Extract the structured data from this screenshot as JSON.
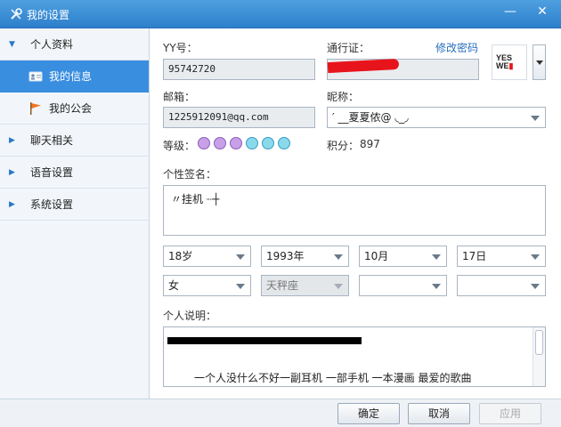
{
  "window": {
    "title": "我的设置",
    "minimize": "—",
    "close": "✕"
  },
  "sidebar": {
    "sections": [
      {
        "label": "个人资料",
        "expanded": true
      },
      {
        "label": "聊天相关",
        "expanded": false
      },
      {
        "label": "语音设置",
        "expanded": false
      },
      {
        "label": "系统设置",
        "expanded": false
      }
    ],
    "sub_items": [
      {
        "label": "我的信息",
        "icon": "id-card-icon",
        "active": true
      },
      {
        "label": "我的公会",
        "icon": "flag-icon",
        "active": false
      }
    ]
  },
  "profile": {
    "yy_label": "YY号：",
    "yy_value": "95742720",
    "passport_label": "通行证：",
    "change_password": "修改密码",
    "email_label": "邮箱：",
    "email_value": "1225912091@qq.com",
    "nickname_label": "昵称：",
    "nickname_value": "′ __夏夏侬@ ◟_◞",
    "level_label": "等级：",
    "level_icons": [
      "crown-icon",
      "crown-icon",
      "crown-icon",
      "diamond-icon",
      "diamond-icon",
      "diamond-icon"
    ],
    "points_label": "积分：",
    "points_value": "897",
    "signature_label": "个性签名：",
    "signature_value": "〃挂机 ┈┼",
    "age": "18岁",
    "birth_year": "1993年",
    "birth_month": "10月",
    "birth_day": "17日",
    "gender": "女",
    "zodiac": "天秤座",
    "province": "",
    "city": "",
    "bio_label": "个人说明：",
    "bio_text": "一个人没什么不好一副耳机 一部手机 一本漫画 最爱的歌曲"
  },
  "avatar": {
    "logo_text_top": "YES",
    "logo_text_bottom": "WE"
  },
  "footer": {
    "ok": "确定",
    "cancel": "取消",
    "apply": "应用"
  },
  "colors": {
    "accent": "#3a8ee0",
    "title_bar": "#2d7fcb",
    "redaction": "#e8141c"
  }
}
